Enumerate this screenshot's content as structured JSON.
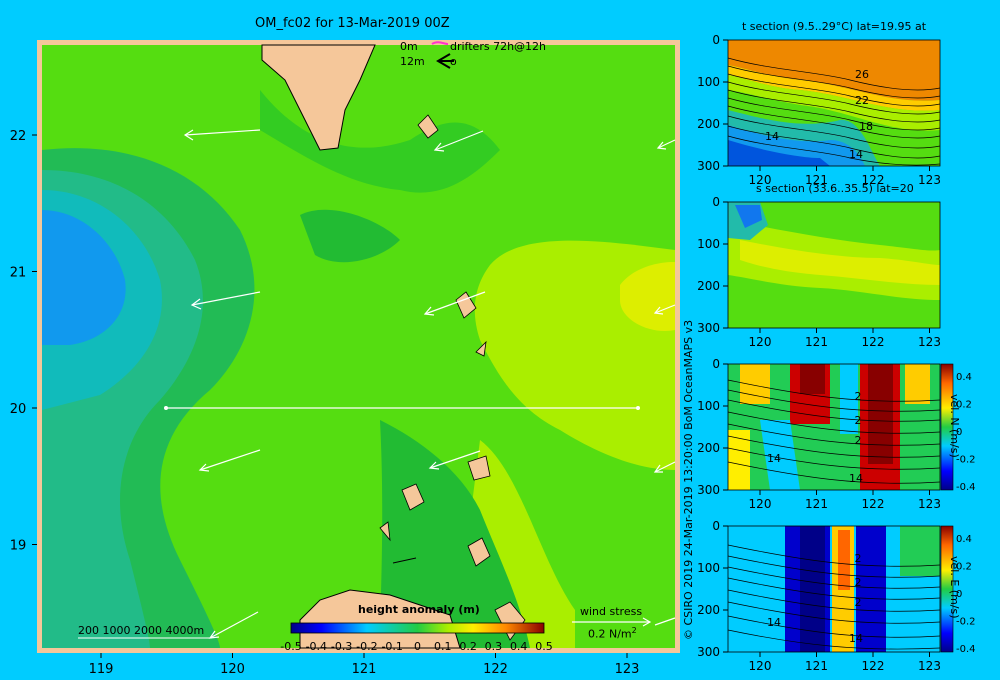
{
  "title": "OM_fc02 for 13-Mar-2019 00Z",
  "legend": {
    "row1_depth": "0m",
    "row1_text": "drifters 72h@12h",
    "row2_depth": "12m",
    "row2_text": "o"
  },
  "main_map": {
    "x_ticks": [
      "119",
      "120",
      "121",
      "122",
      "123"
    ],
    "y_ticks": [
      "22",
      "21",
      "20",
      "19"
    ],
    "scale_text": "200  1000  2000  4000m",
    "wind_stress_label": "wind stress",
    "wind_stress_value": "0.2 N/m",
    "wind_stress_exp": "2",
    "section_line_lat": "20"
  },
  "colorbar": {
    "title": "height anomaly  (m)",
    "ticks": [
      "-0.5",
      "-0.4",
      "-0.3",
      "-0.2",
      "-0.1",
      "0",
      "0.1",
      "0.2",
      "0.3",
      "0.4",
      "0.5"
    ]
  },
  "colors": {
    "background": "#00ccff",
    "land": "#f5c79a",
    "map_frame": "#f5c79a"
  },
  "panels": {
    "t_section_title": "t section (9.5..29°C) lat=19.95 at",
    "s_section_title": "s section (33.6..35.5) lat=20",
    "depth_ticks": [
      "0",
      "100",
      "200",
      "300"
    ],
    "lon_ticks": [
      "120",
      "121",
      "122",
      "123"
    ],
    "t_contour_labels": [
      "26",
      "22",
      "18",
      "14",
      "14"
    ],
    "vn_contour_labels": [
      "2",
      "2",
      "2",
      "14",
      "14"
    ],
    "ve_contour_labels": [
      "2",
      "2",
      "2",
      "14",
      "14"
    ],
    "vn_label": "vel. N (m/s)",
    "ve_label": "vel. E (m/s)",
    "vel_ticks": [
      "0.4",
      "0.2",
      "0",
      "-0.2",
      "-0.4"
    ]
  },
  "credit": "© CSIRO 2019   24-Mar-2019 13:20:00 BoM OceanMAPS v3"
}
